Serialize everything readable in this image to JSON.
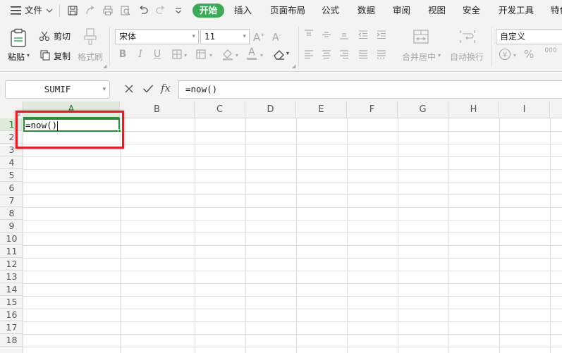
{
  "menu": {
    "file_label": "文件",
    "tabs": [
      "开始",
      "插入",
      "页面布局",
      "公式",
      "数据",
      "审阅",
      "视图",
      "安全",
      "开发工具",
      "特色"
    ]
  },
  "ribbon": {
    "paste_label": "粘贴",
    "cut_label": "剪切",
    "copy_label": "复制",
    "format_painter_label": "格式刷",
    "font_name": "宋体",
    "font_size": "11",
    "merge_center_label": "合并居中",
    "wrap_text_label": "自动换行",
    "number_format": "自定义",
    "percent_symbol": "%",
    "thousands_symbol": "000"
  },
  "formula_bar": {
    "name_box": "SUMIF",
    "cancel_symbol": "×",
    "confirm_symbol": "✓",
    "fx_label": "fx",
    "formula": "=now()"
  },
  "sheet": {
    "columns": [
      "A",
      "B",
      "C",
      "D",
      "E",
      "F",
      "G",
      "H",
      "I"
    ],
    "rows": [
      "1",
      "2",
      "3",
      "4",
      "5",
      "6",
      "7",
      "8",
      "9",
      "10",
      "11",
      "12",
      "13",
      "14",
      "15",
      "16",
      "17",
      "18"
    ],
    "active_cell": {
      "ref": "A1",
      "content": "=now()"
    }
  },
  "colors": {
    "accent_green": "#3dab55",
    "selection_green": "#2e8b3d",
    "annotation_red": "#d9212a"
  }
}
